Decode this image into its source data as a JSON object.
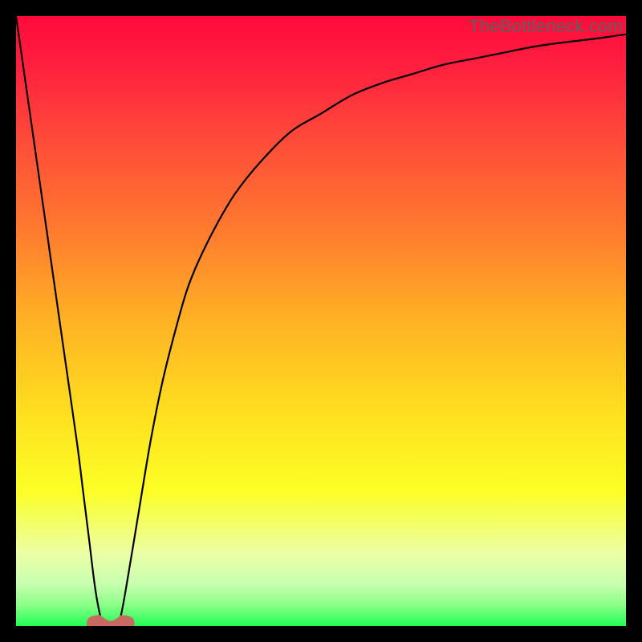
{
  "watermark": "TheBottleneck.com",
  "chart_data": {
    "type": "line",
    "title": "",
    "xlabel": "",
    "ylabel": "",
    "xlim": [
      0,
      100
    ],
    "ylim": [
      0,
      100
    ],
    "grid": false,
    "legend": false,
    "background_gradient": {
      "stops": [
        {
          "offset": 0.0,
          "color": "#ff0a3a"
        },
        {
          "offset": 0.08,
          "color": "#ff1f3f"
        },
        {
          "offset": 0.2,
          "color": "#ff4a39"
        },
        {
          "offset": 0.35,
          "color": "#ff7a2f"
        },
        {
          "offset": 0.5,
          "color": "#ffb224"
        },
        {
          "offset": 0.65,
          "color": "#ffdf1f"
        },
        {
          "offset": 0.78,
          "color": "#fcff26"
        },
        {
          "offset": 0.88,
          "color": "#ecffa5"
        },
        {
          "offset": 0.93,
          "color": "#c9ffb0"
        },
        {
          "offset": 0.965,
          "color": "#8cff88"
        },
        {
          "offset": 1.0,
          "color": "#22ff55"
        }
      ]
    },
    "series": [
      {
        "name": "bottleneck-curve",
        "color": "#000000",
        "width": 2.2,
        "x": [
          0,
          2,
          4,
          6,
          8,
          10,
          11,
          12,
          13,
          14,
          15,
          16,
          17,
          18,
          20,
          22,
          24,
          26,
          28,
          30,
          33,
          36,
          40,
          45,
          50,
          55,
          60,
          65,
          70,
          75,
          80,
          85,
          90,
          95,
          100
        ],
        "y": [
          100,
          86,
          72,
          58,
          44,
          30,
          22,
          14,
          6,
          1,
          0,
          0,
          1,
          6,
          18,
          30,
          40,
          48,
          55,
          60,
          66,
          71,
          76,
          81,
          84,
          87,
          89,
          90.5,
          92,
          93,
          94,
          95,
          95.7,
          96.3,
          97
        ]
      }
    ],
    "marker": {
      "name": "optimal-point",
      "color": "#c96a62",
      "cx": 15.5,
      "cy": 0.5,
      "r_outer": 2.8,
      "r_inner": 1.6
    }
  }
}
